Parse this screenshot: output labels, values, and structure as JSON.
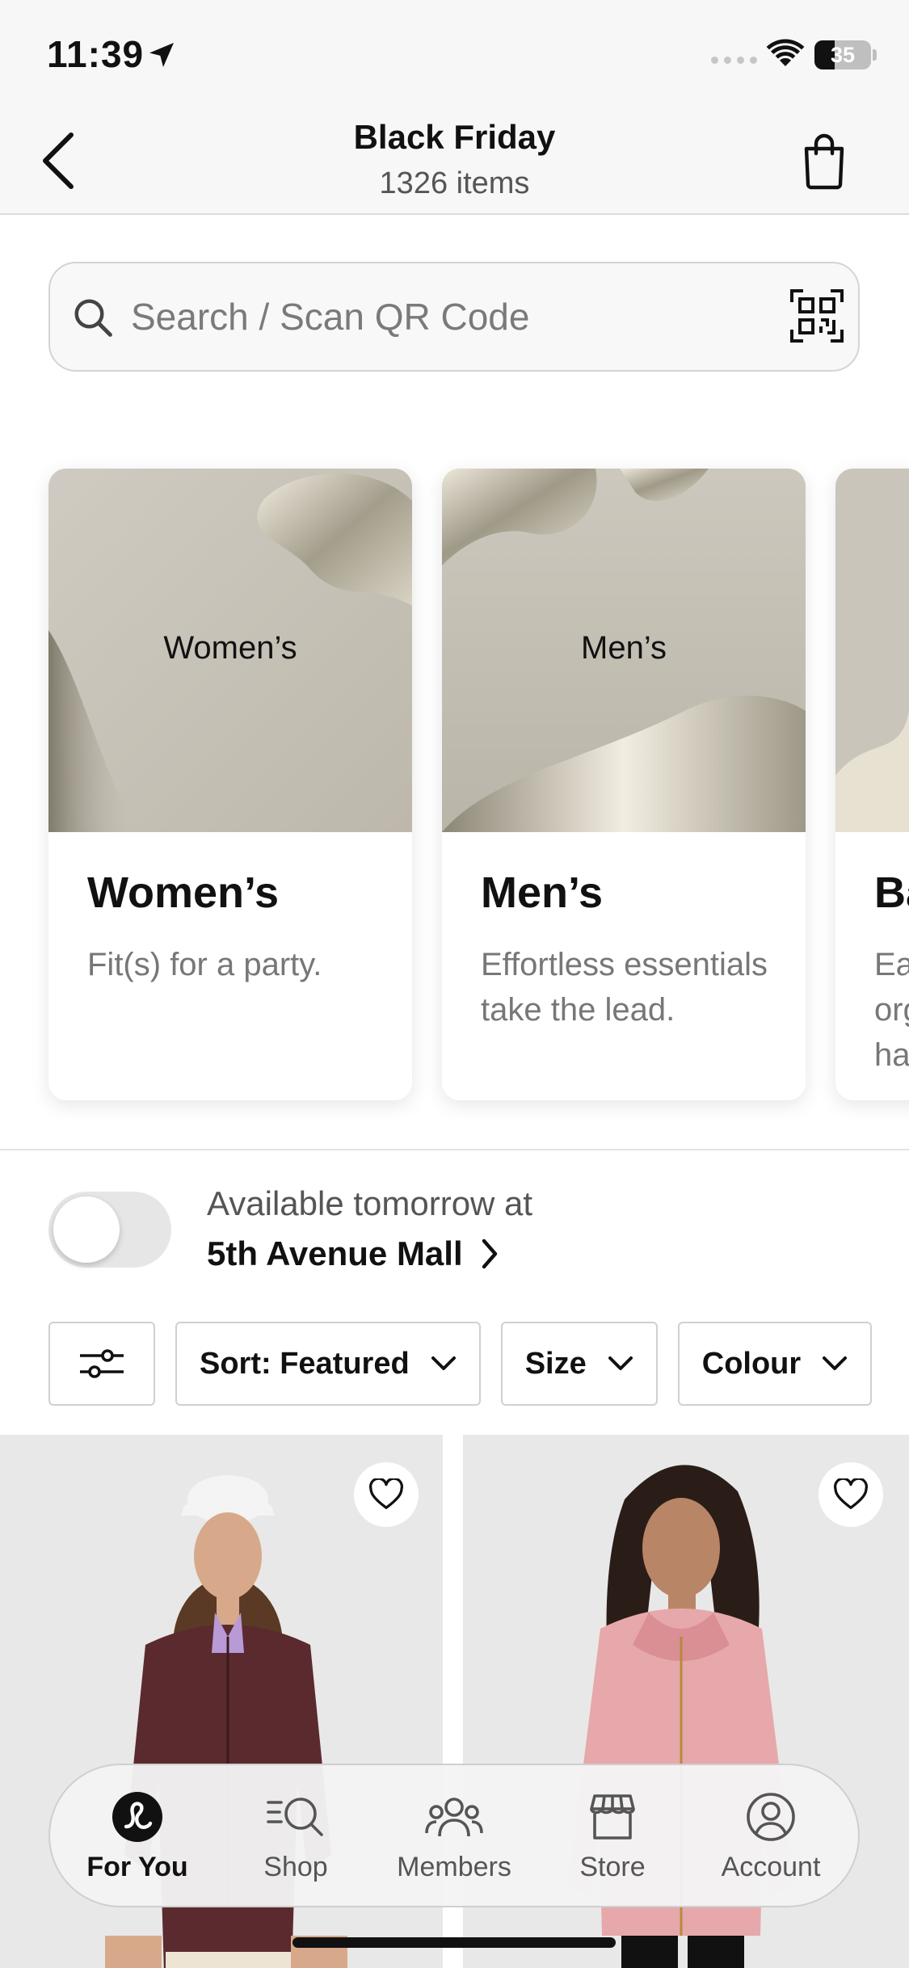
{
  "status_bar": {
    "time": "11:39",
    "battery": "35",
    "battery_level": 0.35
  },
  "header": {
    "title": "Black Friday",
    "subtitle": "1326 items"
  },
  "search": {
    "placeholder": "Search / Scan QR Code"
  },
  "categories": [
    {
      "image_label": "Women’s",
      "title": "Women’s",
      "description": "Fit(s) for a party."
    },
    {
      "image_label": "Men’s",
      "title": "Men’s",
      "description": "Effortless essentials take the lead."
    },
    {
      "title": "Ba",
      "description": "Ea\norg\nha"
    }
  ],
  "availability": {
    "toggle_on": false,
    "label": "Available tomorrow at",
    "store": "5th Avenue Mall"
  },
  "filters": {
    "sort": "Sort: Featured",
    "size": "Size",
    "colour": "Colour"
  },
  "products": [
    {
      "favorited": false
    },
    {
      "favorited": false
    }
  ],
  "tabbar": {
    "active": "for_you",
    "items": [
      {
        "id": "for_you",
        "label": "For You",
        "icon": "lululemon-logo-icon"
      },
      {
        "id": "shop",
        "label": "Shop",
        "icon": "shop-search-icon"
      },
      {
        "id": "members",
        "label": "Members",
        "icon": "members-icon"
      },
      {
        "id": "store",
        "label": "Store",
        "icon": "store-icon"
      },
      {
        "id": "account",
        "label": "Account",
        "icon": "account-icon"
      }
    ]
  },
  "colors": {
    "background": "#ffffff",
    "header_background": "#f7f7f7",
    "text_primary": "#111111",
    "text_secondary": "#777777",
    "border": "#d0d0d0",
    "product_background": "#e9e9e9"
  }
}
